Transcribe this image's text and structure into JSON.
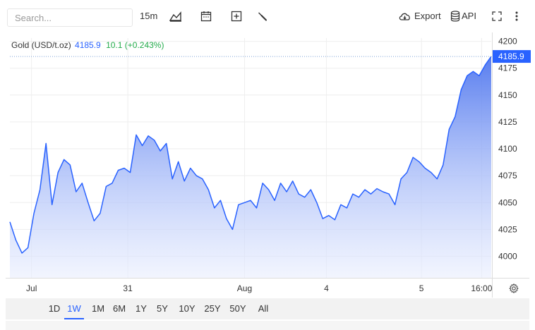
{
  "toolbar": {
    "search_placeholder": "Search...",
    "interval": "15m",
    "export_label": "Export",
    "api_label": "API"
  },
  "legend": {
    "symbol": "Gold (USD/t.oz)",
    "price": "4185.9",
    "change": "10.1 (+0.243%)"
  },
  "range_buttons": [
    "1D",
    "1W",
    "1M",
    "6M",
    "1Y",
    "5Y",
    "10Y",
    "25Y",
    "50Y",
    "All"
  ],
  "active_range": "1W",
  "colors": {
    "line": "#2962ff",
    "fill_top": "#5b80f0",
    "price_tag": "#2962ff",
    "change_up": "#22ab4a"
  },
  "chart_data": {
    "type": "area",
    "series": [
      {
        "x": [
          0,
          0.5,
          1,
          1.5,
          2,
          2.5,
          3,
          3.5,
          4,
          4.5,
          5,
          5.5,
          6,
          6.5,
          7,
          7.5,
          8,
          8.5,
          9,
          9.5,
          10,
          10.5,
          11,
          11.5,
          12,
          12.5,
          13,
          13.5,
          14,
          14.5,
          15,
          15.5,
          16,
          16.5,
          17,
          17.5,
          18,
          18.5,
          19,
          19.5,
          20,
          20.5,
          21,
          21.5,
          22,
          22.5,
          23,
          23.5,
          24,
          24.5,
          25,
          25.5,
          26,
          26.5,
          27,
          27.5,
          28,
          28.5,
          29,
          29.5,
          30,
          30.5,
          31,
          31.5,
          32,
          32.5,
          33,
          33.5,
          34,
          34.5,
          35,
          35.5,
          36,
          36.5,
          37,
          37.5,
          38,
          38.5,
          39,
          39.5,
          40
        ],
        "values": [
          4032,
          4015,
          4003,
          4008,
          4040,
          4062,
          4105,
          4048,
          4078,
          4090,
          4085,
          4060,
          4068,
          4050,
          4033,
          4040,
          4065,
          4068,
          4080,
          4082,
          4078,
          4113,
          4103,
          4112,
          4108,
          4098,
          4105,
          4072,
          4088,
          4070,
          4082,
          4075,
          4072,
          4062,
          4045,
          4052,
          4035,
          4025,
          4048,
          4050,
          4052,
          4045,
          4068,
          4062,
          4052,
          4068,
          4060,
          4070,
          4058,
          4055,
          4062,
          4050,
          4035,
          4038,
          4034,
          4048,
          4045,
          4058,
          4055,
          4062,
          4058,
          4063,
          4060,
          4058,
          4048,
          4072,
          4078,
          4092,
          4088,
          4082,
          4078,
          4072,
          4085,
          4118,
          4130,
          4155,
          4168,
          4172,
          4168,
          4178,
          4186
        ]
      }
    ],
    "x_tick_labels": [
      "Jul",
      "31",
      "Aug",
      "4",
      "5",
      "16:00"
    ],
    "x_tick_positions": [
      1.8,
      9.8,
      19.5,
      26.3,
      34.2,
      39.2
    ],
    "y_ticks": [
      4000,
      4025,
      4050,
      4075,
      4100,
      4125,
      4150,
      4175,
      4200
    ],
    "ylim": [
      3980,
      4203
    ],
    "current_price": 4185.9,
    "grid": true
  }
}
